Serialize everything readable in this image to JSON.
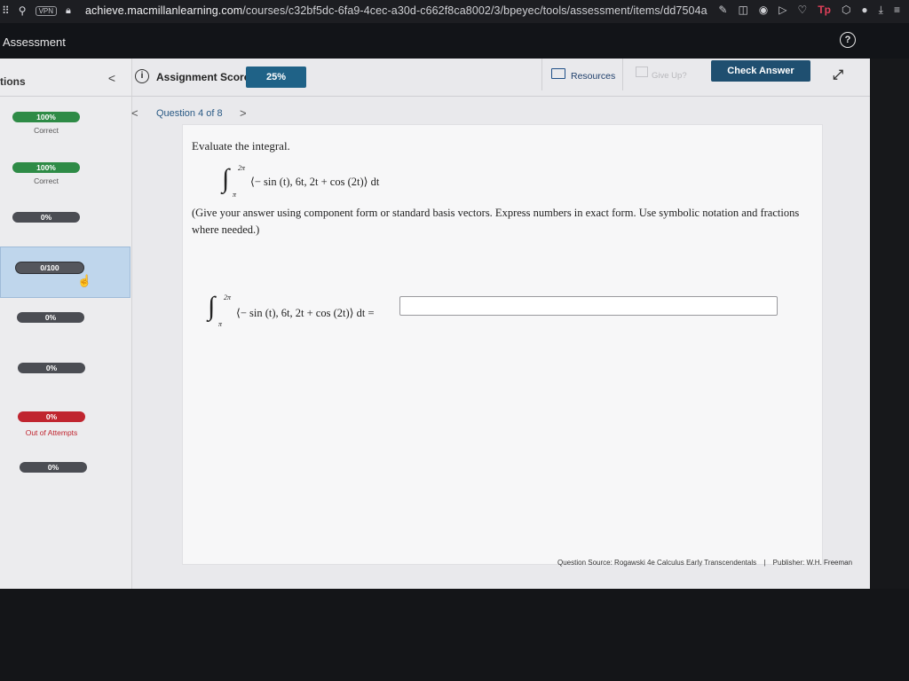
{
  "browser": {
    "vpn_badge": "VPN",
    "url_host": "achieve.macmillanlearning.com",
    "url_path": "/courses/c32bf5dc-6fa9-4cec-a30d-c662f8ca8002/3/bpeyec/tools/assessment/items/dd7504a",
    "right_tp": "Tp"
  },
  "header": {
    "title": "Assessment",
    "help_glyph": "?"
  },
  "sidebar": {
    "label": "tions",
    "collapse_glyph": "<",
    "items": [
      {
        "pill": "100%",
        "status": "Correct",
        "color": "#2e8b46"
      },
      {
        "pill": "100%",
        "status": "Correct",
        "color": "#2e8b46"
      },
      {
        "pill": "0%",
        "status": "",
        "color": "#4b4d53"
      },
      {
        "pill": "0/100",
        "status": "",
        "color": "#54565c",
        "active": true
      },
      {
        "pill": "0%",
        "status": "",
        "color": "#4b4d53"
      },
      {
        "pill": "0%",
        "status": "",
        "color": "#4b4d53"
      },
      {
        "pill": "0%",
        "status": "Out of Attempts",
        "color": "#c0252f"
      },
      {
        "pill": "0%",
        "status": "",
        "color": "#4b4d53"
      }
    ]
  },
  "topbar": {
    "score_label": "Assignment Score:",
    "score_value": "25%",
    "resources_label": "Resources",
    "give_up_label": "Give Up?",
    "check_answer_label": "Check Answer"
  },
  "question_nav": {
    "prev": "<",
    "label": "Question 4 of 8",
    "next": ">"
  },
  "question": {
    "prompt": "Evaluate the integral.",
    "upper_limit": "2π",
    "lower_limit": "π",
    "integrand": "⟨− sin (t), 6t, 2t + cos (2t)⟩ dt",
    "instructions": "(Give your answer using component form or standard basis vectors. Express numbers in exact form. Use symbolic notation and fractions where needed.)",
    "answer_lhs": "⟨− sin (t), 6t, 2t + cos (2t)⟩ dt =",
    "answer_value": ""
  },
  "footer": {
    "source": "Question Source: Rogawski 4e Calculus Early Transcendentals",
    "separator": "|",
    "publisher": "Publisher: W.H. Freeman"
  }
}
